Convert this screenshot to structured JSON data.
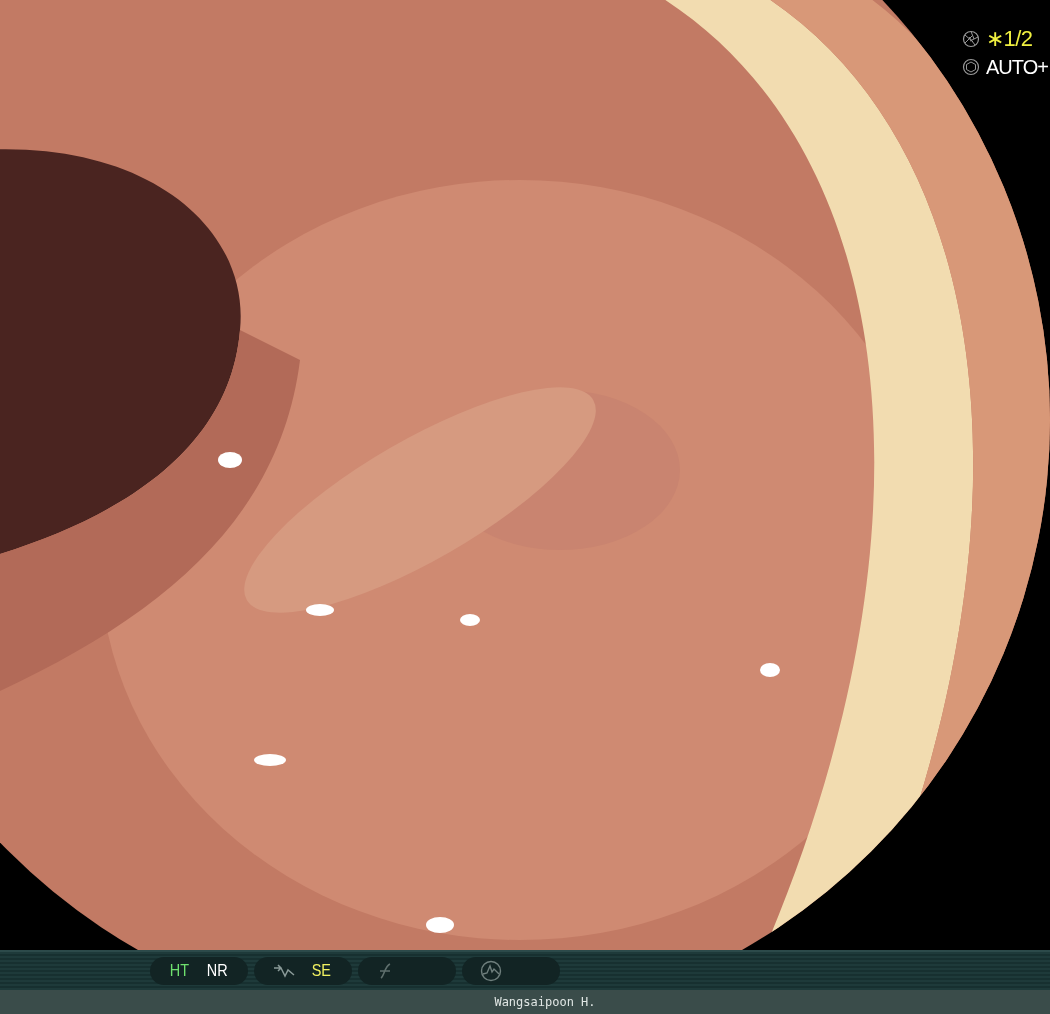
{
  "overlay": {
    "shutter": {
      "text": "∗1/2"
    },
    "iris": {
      "text": "AUTO+"
    }
  },
  "status_bar": {
    "groups": [
      {
        "kind": "plain",
        "labels": [
          {
            "text": "HT",
            "color": "#6ee06e"
          },
          {
            "text": "NR",
            "color": "#ffffff"
          }
        ]
      },
      {
        "kind": "curve",
        "labels": [
          {
            "text": "SE",
            "color": "#f0f060"
          }
        ]
      },
      {
        "kind": "f"
      },
      {
        "kind": "wave"
      }
    ]
  },
  "operator": "Wangsaipoon H."
}
